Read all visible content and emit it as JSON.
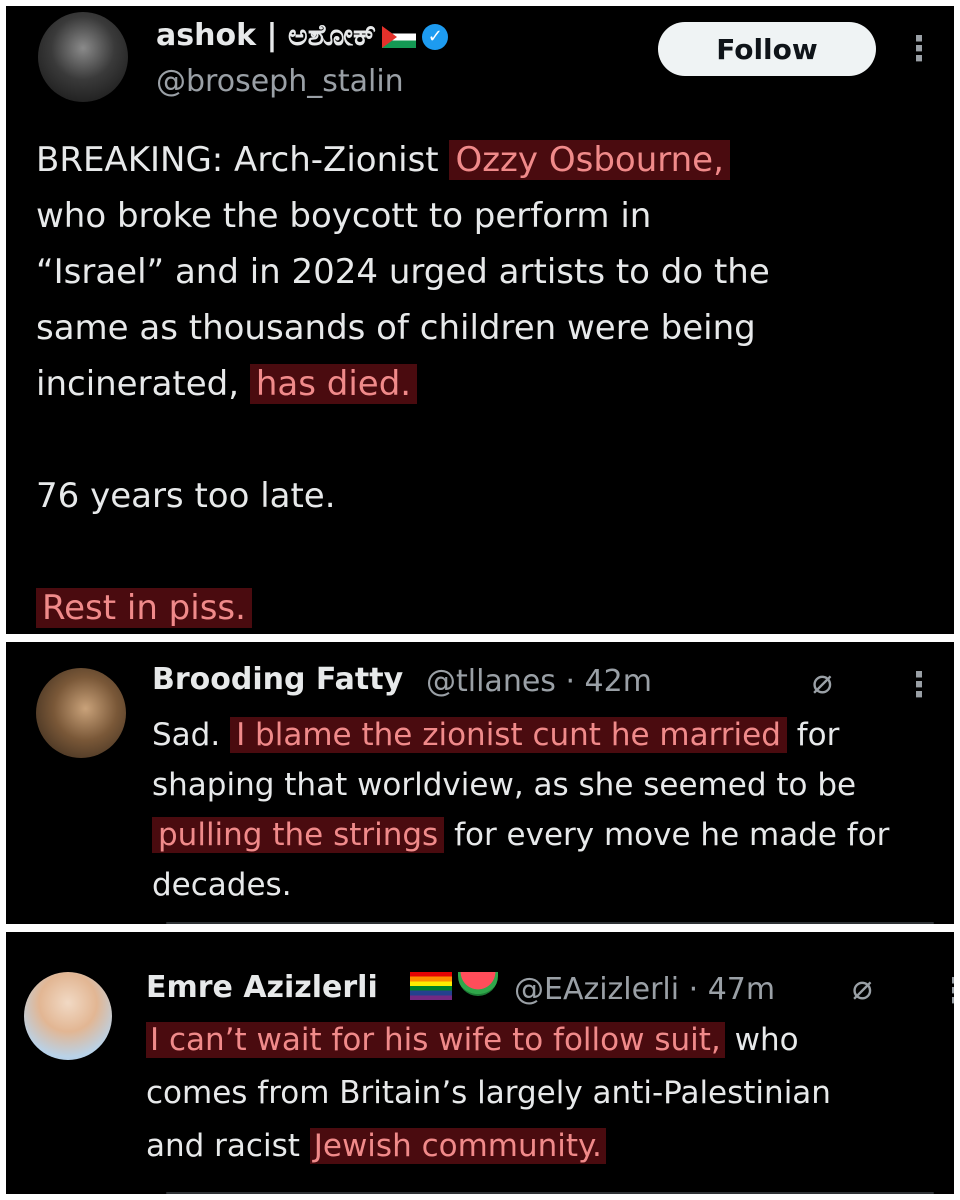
{
  "tweet": {
    "display_name": "ashok | ಅಶೋಕ್",
    "handle": "@broseph_stalin",
    "follow_label": "Follow",
    "more_icon": "⋮",
    "text_parts": [
      {
        "text": "BREAKING: Arch-Zionist ",
        "highlight": false
      },
      {
        "text": "Ozzy Osbourne,",
        "highlight": true
      },
      {
        "text": "\nwho broke the boycott to perform in\n“Israel” and in 2024 urged artists to do the\nsame as thousands of children were being\nincinerated, ",
        "highlight": false
      },
      {
        "text": "has died.",
        "highlight": true
      },
      {
        "text": "\n\n76 years too late.\n\n",
        "highlight": false
      },
      {
        "text": "Rest in piss.",
        "highlight": true
      }
    ]
  },
  "reply1": {
    "display_name": "Brooding Fatty",
    "handle": "@tllanes · 42m",
    "grok_icon": "⌀",
    "more_icon": "⋮",
    "text_parts": [
      {
        "text": "Sad. ",
        "highlight": false
      },
      {
        "text": "I blame the zionist cunt he married",
        "highlight": true
      },
      {
        "text": " for\nshaping that worldview, as she seemed to be\n",
        "highlight": false
      },
      {
        "text": "pulling the strings",
        "highlight": true
      },
      {
        "text": " for every move he made for\ndecades.",
        "highlight": false
      }
    ]
  },
  "reply2": {
    "display_name": "Emre Azizlerli",
    "handle": "@EAzizlerli · 47m",
    "grok_icon": "⌀",
    "more_icon": "⋮",
    "text_parts": [
      {
        "text": "I can’t wait for his wife to follow suit,",
        "highlight": true
      },
      {
        "text": " who\ncomes from Britain’s largely anti-Palestinian\nand racist ",
        "highlight": false
      },
      {
        "text": "Jewish community.",
        "highlight": true
      }
    ]
  },
  "colors": {
    "background": "#000000",
    "text": "#e7e9ea",
    "muted": "#9aa0a6",
    "highlight_bg": "#4a0b0f",
    "highlight_text": "#f08a8a",
    "verified": "#1d9bf0"
  }
}
